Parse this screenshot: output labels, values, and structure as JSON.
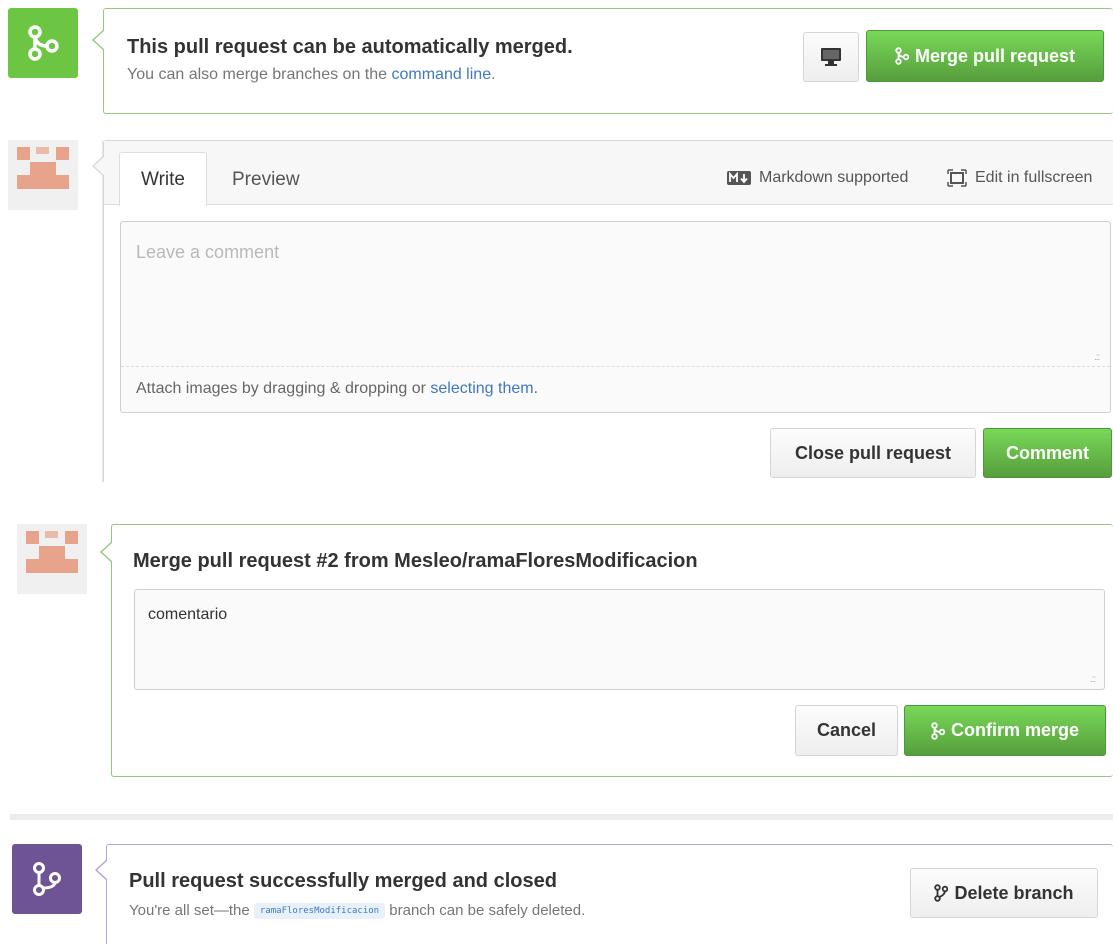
{
  "mergeable": {
    "title": "This pull request can be automatically merged.",
    "subtitle_prefix": "You can also merge branches on the ",
    "subtitle_link": "command line",
    "subtitle_suffix": ".",
    "merge_button": "Merge pull request"
  },
  "comment_form": {
    "tabs": [
      "Write",
      "Preview"
    ],
    "markdown_label": "Markdown supported",
    "fullscreen_label": "Edit in fullscreen",
    "placeholder": "Leave a comment",
    "attach_prefix": "Attach images by dragging & dropping or ",
    "attach_link": "selecting them",
    "attach_suffix": ".",
    "close_button": "Close pull request",
    "comment_button": "Comment"
  },
  "confirm": {
    "title": "Merge pull request #2 from Mesleo/ramaFloresModificacion",
    "message": "comentario",
    "cancel_button": "Cancel",
    "confirm_button": "Confirm merge"
  },
  "merged": {
    "title": "Pull request successfully merged and closed",
    "subtitle_prefix": "You're all set—the ",
    "branch": "ramaFloresModificacion",
    "subtitle_suffix": " branch can be safely deleted.",
    "delete_button": "Delete branch"
  },
  "colors": {
    "green": "#6cc644",
    "purple": "#6e5494",
    "link": "#4078c0"
  }
}
